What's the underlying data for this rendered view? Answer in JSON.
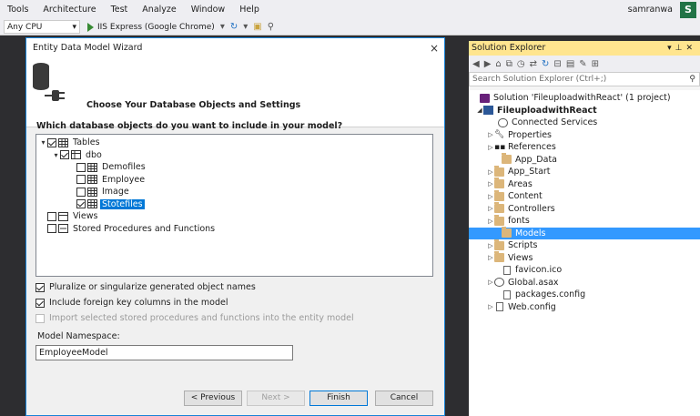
{
  "menu": [
    "Tools",
    "Architecture",
    "Test",
    "Analyze",
    "Window",
    "Help"
  ],
  "user": {
    "name": "samranwa",
    "avatar_letter": "S"
  },
  "toolbar": {
    "platform": "Any CPU",
    "run_target": "IIS Express (Google Chrome)"
  },
  "wizard": {
    "title": "Entity Data Model Wizard",
    "header": "Choose Your Database Objects and Settings",
    "question": "Which database objects do you want to include in your model?",
    "tree": {
      "tables": "Tables",
      "dbo": "dbo",
      "items": [
        "Demofiles",
        "Employee",
        "Image",
        "Stotefiles"
      ],
      "views": "Views",
      "procs": "Stored Procedures and Functions"
    },
    "options": {
      "pluralize": "Pluralize or singularize generated object names",
      "foreign_keys": "Include foreign key columns in the model",
      "import_procs": "Import selected stored procedures and functions into the entity model"
    },
    "namespace_label": "Model Namespace:",
    "namespace_value": "EmployeeModel",
    "buttons": {
      "previous": "< Previous",
      "next": "Next >",
      "finish": "Finish",
      "cancel": "Cancel"
    }
  },
  "solution_explorer": {
    "title": "Solution Explorer",
    "search_placeholder": "Search Solution Explorer (Ctrl+;)",
    "solution": "Solution 'FileuploadwithReact' (1 project)",
    "project": "FileuploadwithReact",
    "items": [
      "Connected Services",
      "Properties",
      "References",
      "App_Data",
      "App_Start",
      "Areas",
      "Content",
      "Controllers",
      "fonts",
      "Models",
      "Scripts",
      "Views",
      "favicon.ico",
      "Global.asax",
      "packages.config",
      "Web.config"
    ]
  }
}
